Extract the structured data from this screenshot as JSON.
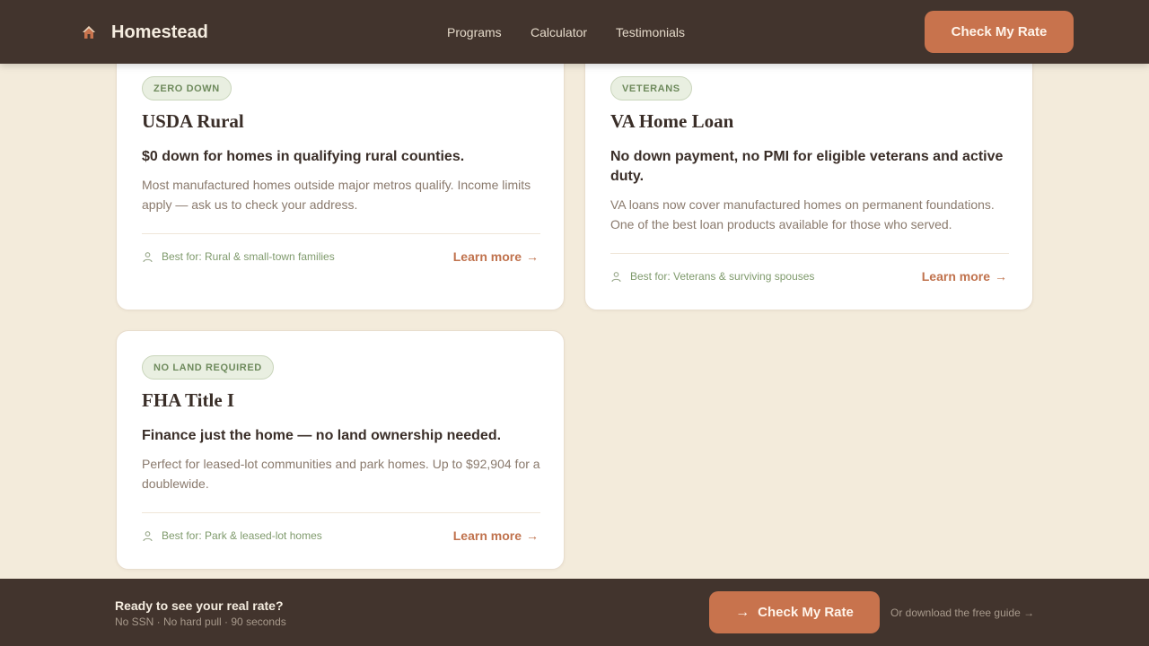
{
  "header": {
    "brand": "Homestead",
    "nav": [
      "Programs",
      "Calculator",
      "Testimonials"
    ],
    "cta": "Check My Rate"
  },
  "cards": [
    {
      "badge": "ZERO DOWN",
      "title": "USDA Rural",
      "subtitle": "$0 down for homes in qualifying rural counties.",
      "description": "Most manufactured homes outside major metros qualify. Income limits apply — ask us to check your address.",
      "best_for": "Best for: Rural & small-town families",
      "link": "Learn more",
      "arrow": "→"
    },
    {
      "badge": "VETERANS",
      "title": "VA Home Loan",
      "subtitle": "No down payment, no PMI for eligible veterans and active duty.",
      "description": "VA loans now cover manufactured homes on permanent foundations. One of the best loan products available for those who served.",
      "best_for": "Best for: Veterans & surviving spouses",
      "link": "Learn more",
      "arrow": "→"
    },
    {
      "badge": "NO LAND REQUIRED",
      "title": "FHA Title I",
      "subtitle": "Finance just the home — no land ownership needed.",
      "description": "Perfect for leased-lot communities and park homes. Up to $92,904 for a doublewide.",
      "best_for": "Best for: Park & leased-lot homes",
      "link": "Learn more",
      "arrow": "→"
    }
  ],
  "footer": {
    "title": "Ready to see your real rate?",
    "subtitle": "No SSN · No hard pull · 90 seconds",
    "cta": "Check My Rate",
    "cta_arrow": "→",
    "guide_link": "Or download the free guide →"
  },
  "colors": {
    "header_bg": "#42342d",
    "page_bg": "#f3ebdb",
    "accent": "#c8734d",
    "badge_green": "#6e8a5c"
  },
  "icons": {
    "brand": "house-icon",
    "best_for": "people-icon",
    "arrow": "arrow-right-icon"
  }
}
